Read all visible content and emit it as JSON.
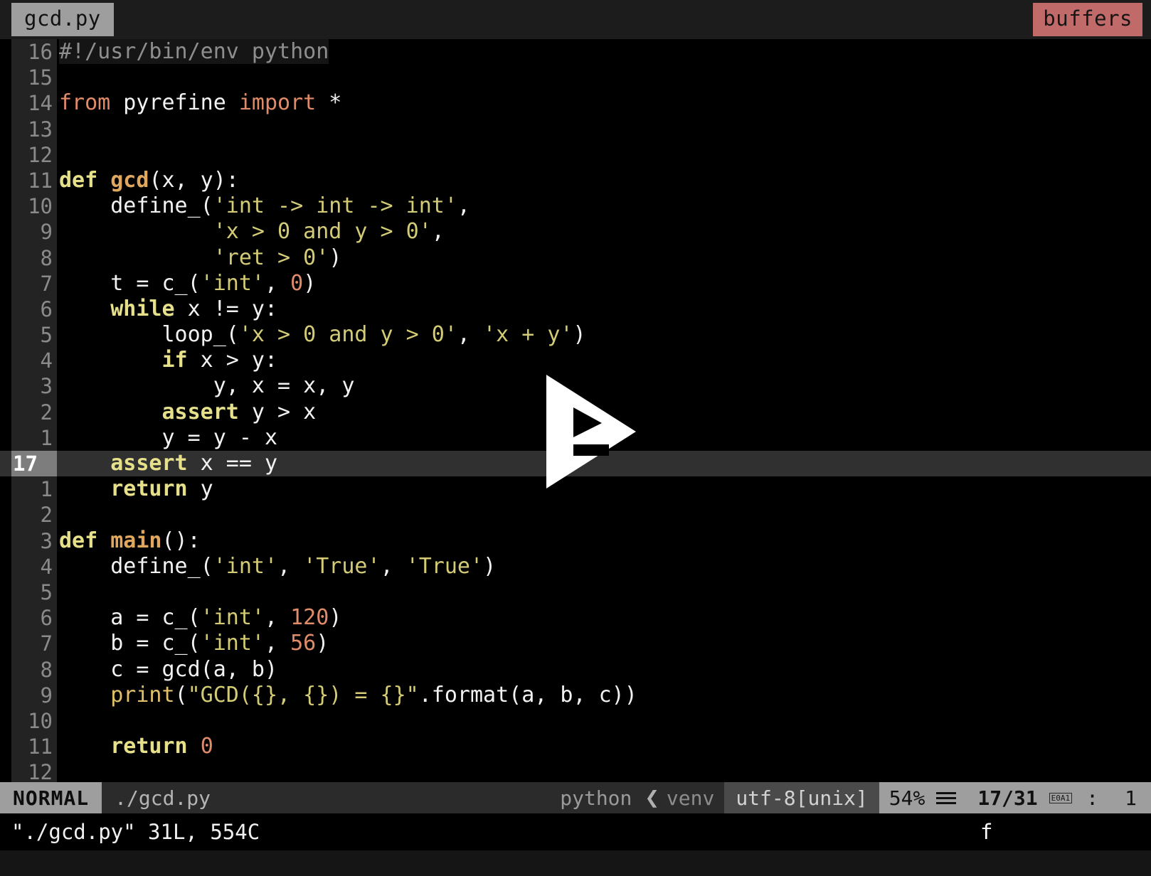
{
  "tabline": {
    "tab_label": "gcd.py",
    "buffers_label": "buffers",
    "buffers_color": "#c16a6a",
    "tab_bg": "#9e9e9e"
  },
  "editor": {
    "current_line_number": "17",
    "lines": [
      {
        "num": "16",
        "tokens": [
          {
            "t": "#!/usr/bin/env python",
            "c": "t-comment"
          }
        ]
      },
      {
        "num": "15",
        "tokens": []
      },
      {
        "num": "14",
        "tokens": [
          {
            "t": "from",
            "c": "t-import"
          },
          {
            "t": " pyrefine ",
            "c": "t-plain"
          },
          {
            "t": "import",
            "c": "t-import"
          },
          {
            "t": " *",
            "c": "t-plain"
          }
        ]
      },
      {
        "num": "13",
        "tokens": []
      },
      {
        "num": "12",
        "tokens": []
      },
      {
        "num": "11",
        "tokens": [
          {
            "t": "def",
            "c": "t-kw"
          },
          {
            "t": " ",
            "c": "t-plain"
          },
          {
            "t": "gcd",
            "c": "t-fn"
          },
          {
            "t": "(x, y):",
            "c": "t-plain"
          }
        ]
      },
      {
        "num": "10",
        "tokens": [
          {
            "t": "    define_(",
            "c": "t-plain"
          },
          {
            "t": "'int -> int -> int'",
            "c": "t-str"
          },
          {
            "t": ",",
            "c": "t-plain"
          }
        ]
      },
      {
        "num": "9",
        "tokens": [
          {
            "t": "            ",
            "c": "t-plain"
          },
          {
            "t": "'x > 0 and y > 0'",
            "c": "t-str"
          },
          {
            "t": ",",
            "c": "t-plain"
          }
        ]
      },
      {
        "num": "8",
        "tokens": [
          {
            "t": "            ",
            "c": "t-plain"
          },
          {
            "t": "'ret > 0'",
            "c": "t-str"
          },
          {
            "t": ")",
            "c": "t-plain"
          }
        ]
      },
      {
        "num": "7",
        "tokens": [
          {
            "t": "    t = c_(",
            "c": "t-plain"
          },
          {
            "t": "'int'",
            "c": "t-str"
          },
          {
            "t": ", ",
            "c": "t-plain"
          },
          {
            "t": "0",
            "c": "t-num"
          },
          {
            "t": ")",
            "c": "t-plain"
          }
        ]
      },
      {
        "num": "6",
        "tokens": [
          {
            "t": "    ",
            "c": "t-plain"
          },
          {
            "t": "while",
            "c": "t-kw"
          },
          {
            "t": " x != y:",
            "c": "t-plain"
          }
        ]
      },
      {
        "num": "5",
        "tokens": [
          {
            "t": "        loop_(",
            "c": "t-plain"
          },
          {
            "t": "'x > 0 and y > 0'",
            "c": "t-str"
          },
          {
            "t": ", ",
            "c": "t-plain"
          },
          {
            "t": "'x + y'",
            "c": "t-str"
          },
          {
            "t": ")",
            "c": "t-plain"
          }
        ]
      },
      {
        "num": "4",
        "tokens": [
          {
            "t": "        ",
            "c": "t-plain"
          },
          {
            "t": "if",
            "c": "t-kw"
          },
          {
            "t": " x > y:",
            "c": "t-plain"
          }
        ]
      },
      {
        "num": "3",
        "tokens": [
          {
            "t": "            y, x = x, y",
            "c": "t-plain"
          }
        ]
      },
      {
        "num": "2",
        "tokens": [
          {
            "t": "        ",
            "c": "t-plain"
          },
          {
            "t": "assert",
            "c": "t-kw"
          },
          {
            "t": " y > x",
            "c": "t-plain"
          }
        ]
      },
      {
        "num": "1",
        "tokens": [
          {
            "t": "        y = y - x",
            "c": "t-plain"
          }
        ]
      },
      {
        "num": "17",
        "current": true,
        "tokens": [
          {
            "t": "    ",
            "c": "t-plain"
          },
          {
            "t": "assert",
            "c": "t-kw"
          },
          {
            "t": " x == y",
            "c": "t-plain"
          }
        ]
      },
      {
        "num": "1",
        "tokens": [
          {
            "t": "    ",
            "c": "t-plain"
          },
          {
            "t": "return",
            "c": "t-kw"
          },
          {
            "t": " y",
            "c": "t-plain"
          }
        ]
      },
      {
        "num": "2",
        "tokens": []
      },
      {
        "num": "3",
        "tokens": [
          {
            "t": "def",
            "c": "t-kw"
          },
          {
            "t": " ",
            "c": "t-plain"
          },
          {
            "t": "main",
            "c": "t-fn"
          },
          {
            "t": "():",
            "c": "t-plain"
          }
        ]
      },
      {
        "num": "4",
        "tokens": [
          {
            "t": "    define_(",
            "c": "t-plain"
          },
          {
            "t": "'int'",
            "c": "t-str"
          },
          {
            "t": ", ",
            "c": "t-plain"
          },
          {
            "t": "'True'",
            "c": "t-str"
          },
          {
            "t": ", ",
            "c": "t-plain"
          },
          {
            "t": "'True'",
            "c": "t-str"
          },
          {
            "t": ")",
            "c": "t-plain"
          }
        ]
      },
      {
        "num": "5",
        "tokens": []
      },
      {
        "num": "6",
        "tokens": [
          {
            "t": "    a = c_(",
            "c": "t-plain"
          },
          {
            "t": "'int'",
            "c": "t-str"
          },
          {
            "t": ", ",
            "c": "t-plain"
          },
          {
            "t": "120",
            "c": "t-num"
          },
          {
            "t": ")",
            "c": "t-plain"
          }
        ]
      },
      {
        "num": "7",
        "tokens": [
          {
            "t": "    b = c_(",
            "c": "t-plain"
          },
          {
            "t": "'int'",
            "c": "t-str"
          },
          {
            "t": ", ",
            "c": "t-plain"
          },
          {
            "t": "56",
            "c": "t-num"
          },
          {
            "t": ")",
            "c": "t-plain"
          }
        ]
      },
      {
        "num": "8",
        "tokens": [
          {
            "t": "    c = gcd(a, b)",
            "c": "t-plain"
          }
        ]
      },
      {
        "num": "9",
        "tokens": [
          {
            "t": "    ",
            "c": "t-plain"
          },
          {
            "t": "print",
            "c": "t-call"
          },
          {
            "t": "(",
            "c": "t-plain"
          },
          {
            "t": "\"GCD({}, {}) = {}\"",
            "c": "t-str"
          },
          {
            "t": ".format(a, b, c))",
            "c": "t-plain"
          }
        ]
      },
      {
        "num": "10",
        "tokens": []
      },
      {
        "num": "11",
        "tokens": [
          {
            "t": "    ",
            "c": "t-plain"
          },
          {
            "t": "return",
            "c": "t-kw"
          },
          {
            "t": " ",
            "c": "t-plain"
          },
          {
            "t": "0",
            "c": "t-num"
          }
        ]
      },
      {
        "num": "12",
        "tokens": []
      }
    ]
  },
  "overlay": {
    "play_button_label": "play"
  },
  "statusline": {
    "mode": "NORMAL",
    "file": "./gcd.py",
    "filetype": "python",
    "separator": "❮",
    "venv": "venv",
    "encoding": "utf-8[unix]",
    "percent": "54%",
    "position": "17/31",
    "glyph": "E0A1",
    "colon": ":",
    "column": "1"
  },
  "cmdline": {
    "message": "\"./gcd.py\" 31L, 554C",
    "pending_key": "f"
  }
}
